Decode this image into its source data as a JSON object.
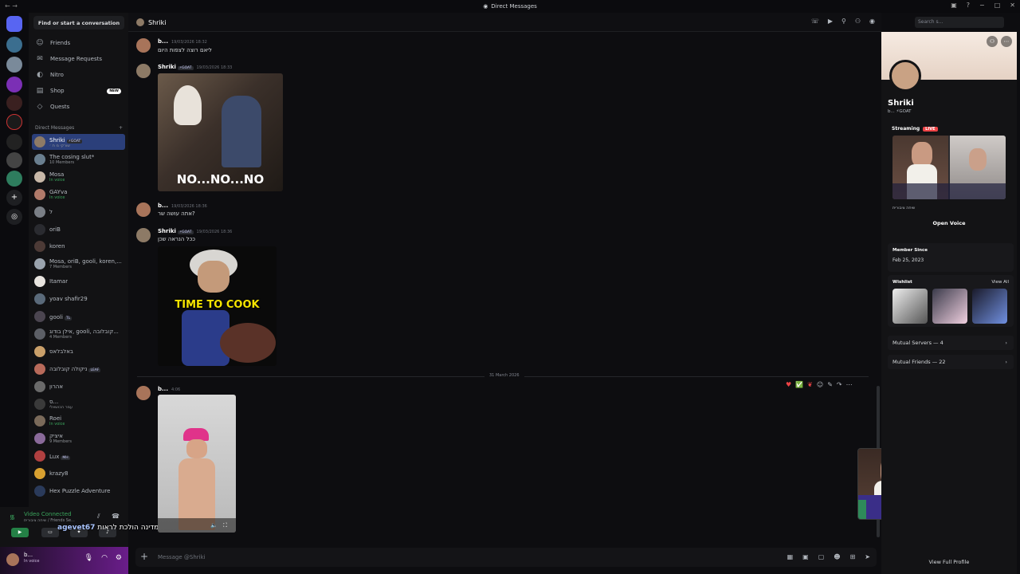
{
  "window": {
    "title": "Direct Messages",
    "controls": [
      "−",
      "□",
      "✕"
    ]
  },
  "sidebar": {
    "search_button": "Find or start a conversation",
    "nav": [
      {
        "label": "Friends",
        "icon": "friends-icon"
      },
      {
        "label": "Message Requests",
        "icon": "mail-icon"
      },
      {
        "label": "Nitro",
        "icon": "nitro-icon"
      },
      {
        "label": "Shop",
        "icon": "shop-icon",
        "badge": "NEW"
      },
      {
        "label": "Quests",
        "icon": "quests-icon"
      }
    ],
    "dm_header": "Direct Messages",
    "dms": [
      {
        "name": "Shriki",
        "tag": "⚡GOAT",
        "sub": "שורקי מ ת ׳",
        "selected": true
      },
      {
        "name": "The cosing slut*",
        "sub": "10 Members"
      },
      {
        "name": "Mosa",
        "sub": "In voice"
      },
      {
        "name": "GAYva",
        "sub": "In voice"
      },
      {
        "name": "ל",
        "sub": ""
      },
      {
        "name": "oriB",
        "sub": ""
      },
      {
        "name": "koren",
        "sub": ""
      },
      {
        "name": "Mosa, oriB, gooli, koren,...",
        "sub": "7 Members"
      },
      {
        "name": "Itamar",
        "sub": ""
      },
      {
        "name": "yoav shafir29",
        "sub": ""
      },
      {
        "name": "gooli",
        "tag": "TL",
        "sub": ""
      },
      {
        "name": "אילן בודוג, gooli, קובלובה...",
        "sub": "4 Members"
      },
      {
        "name": "באלבלאס",
        "sub": ""
      },
      {
        "name": "ניקולה קובלובה",
        "tag": "LEAF",
        "sub": ""
      },
      {
        "name": "אהרון",
        "sub": ""
      },
      {
        "name": "ס...",
        "sub": "עמר הכושאלי"
      },
      {
        "name": "Roei",
        "sub": "In voice"
      },
      {
        "name": "איציק",
        "sub": "9 Members"
      },
      {
        "name": "Lux",
        "tag": "MH",
        "sub": ""
      },
      {
        "name": "krazy8",
        "sub": ""
      },
      {
        "name": "Hex Puzzle Adventure",
        "sub": ""
      }
    ]
  },
  "voice": {
    "status": "Video Connected",
    "sub": "שיחה ציבורית / Friends Se..."
  },
  "overlay": {
    "user": "agevet67",
    "text": "כל המדינה הולכת לראות"
  },
  "user_panel": {
    "name": "b...",
    "status": "In voice"
  },
  "chat": {
    "channel_name": "Shriki",
    "search_placeholder": "Search s...",
    "messages": [
      {
        "author": "b...",
        "date": "19/03/2026 18:32",
        "text": "ליאם רוצה לצפות היום"
      },
      {
        "author": "Shriki",
        "tag": "⚡GOAT",
        "date": "19/03/2026 18:33",
        "gif_caption": "NO...NO...NO"
      },
      {
        "author": "b...",
        "date": "19/03/2026 18:36",
        "text": "אתה עושה שר?"
      },
      {
        "author": "Shriki",
        "tag": "⚡GOAT",
        "date": "19/03/2026 18:36",
        "text": "ככל הנראה שכן",
        "gif_caption": "TIME TO COOK"
      },
      {
        "author": "b...",
        "date": "4:06"
      }
    ],
    "divider": "31 March 2026",
    "composer_placeholder": "Message @Shriki"
  },
  "profile": {
    "name": "Shriki",
    "sub": "b... ⚡GOAT",
    "streaming_label": "Streaming",
    "live_badge": "LIVE",
    "voice_info": "שיחה ציבורית",
    "open_voice": "Open Voice",
    "member_since_label": "Member Since",
    "member_since": "Feb 25, 2023",
    "wishlist_label": "Wishlist",
    "view_all": "View All",
    "mutual_servers": "Mutual Servers — 4",
    "mutual_friends": "Mutual Friends — 22",
    "view_full": "View Full Profile"
  },
  "colors": {
    "accent": "#5865f2",
    "selected_dm": "#2b3f7a",
    "voice_green": "#3ba55d",
    "live_red": "#ed4245"
  }
}
